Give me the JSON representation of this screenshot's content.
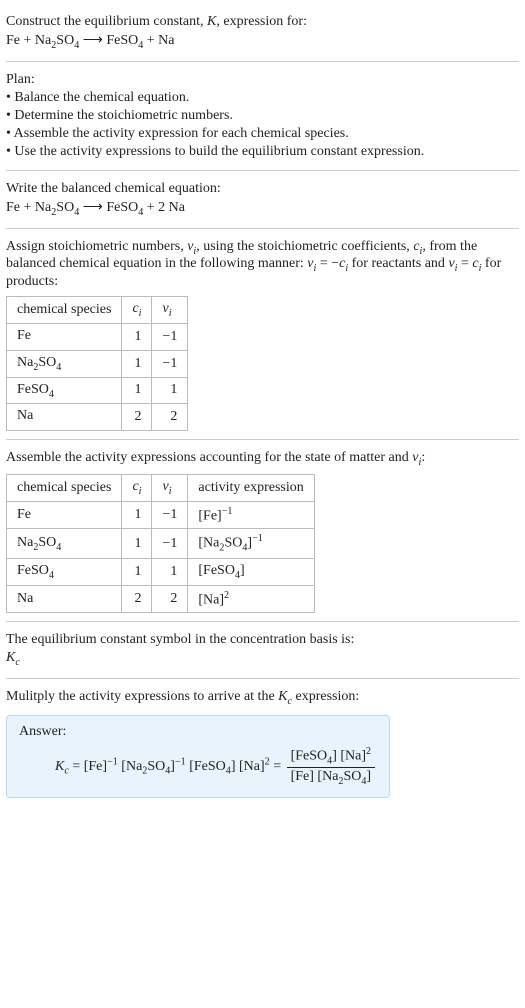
{
  "intro": {
    "line1_a": "Construct the equilibrium constant, ",
    "line1_K": "K",
    "line1_b": ", expression for:",
    "eq_lhs_1": "Fe + Na",
    "eq_lhs_2": "2",
    "eq_lhs_3": "SO",
    "eq_lhs_4": "4",
    "arrow": "  ⟶  ",
    "eq_rhs_1": "FeSO",
    "eq_rhs_2": "4",
    "eq_rhs_3": " + Na"
  },
  "plan": {
    "title": "Plan:",
    "b1": "• Balance the chemical equation.",
    "b2": "• Determine the stoichiometric numbers.",
    "b3": "• Assemble the activity expression for each chemical species.",
    "b4": "• Use the activity expressions to build the equilibrium constant expression."
  },
  "balanced": {
    "title": "Write the balanced chemical equation:",
    "l1": "Fe + Na",
    "l2": "2",
    "l3": "SO",
    "l4": "4",
    "arrow": "  ⟶  ",
    "r1": "FeSO",
    "r2": "4",
    "r3": " + 2 Na"
  },
  "assign": {
    "text_a": "Assign stoichiometric numbers, ",
    "nu": "ν",
    "i": "i",
    "text_b": ", using the stoichiometric coefficients, ",
    "c": "c",
    "text_c": ", from the balanced chemical equation in the following manner: ",
    "eq1_lhs_nu": "ν",
    "eq1_eq": " = −",
    "eq1_rhs_c": "c",
    "text_d": " for reactants and ",
    "eq2_eq": " = ",
    "text_e": " for products:"
  },
  "table1": {
    "h1": "chemical species",
    "h2_c": "c",
    "h2_i": "i",
    "h3_nu": "ν",
    "h3_i": "i",
    "rows": [
      {
        "sp_a": "Fe",
        "sp_b": "",
        "sp_c": "",
        "sp_d": "",
        "c": "1",
        "nu": "−1"
      },
      {
        "sp_a": "Na",
        "sp_b": "2",
        "sp_c": "SO",
        "sp_d": "4",
        "c": "1",
        "nu": "−1"
      },
      {
        "sp_a": "FeSO",
        "sp_b": "4",
        "sp_c": "",
        "sp_d": "",
        "c": "1",
        "nu": "1"
      },
      {
        "sp_a": "Na",
        "sp_b": "",
        "sp_c": "",
        "sp_d": "",
        "c": "2",
        "nu": "2"
      }
    ]
  },
  "assemble": {
    "text_a": "Assemble the activity expressions accounting for the state of matter and ",
    "nu": "ν",
    "i": "i",
    "colon": ":"
  },
  "table2": {
    "h1": "chemical species",
    "h2_c": "c",
    "h2_i": "i",
    "h3_nu": "ν",
    "h3_i": "i",
    "h4": "activity expression",
    "rows": [
      {
        "sp_a": "Fe",
        "sp_b": "",
        "sp_c": "",
        "sp_d": "",
        "c": "1",
        "nu": "−1",
        "ax_a": "[Fe]",
        "ax_sup": "−1",
        "ax_b": ""
      },
      {
        "sp_a": "Na",
        "sp_b": "2",
        "sp_c": "SO",
        "sp_d": "4",
        "c": "1",
        "nu": "−1",
        "ax_a": "[Na",
        "ax_sub1": "2",
        "ax_mid": "SO",
        "ax_sub2": "4",
        "ax_close": "]",
        "ax_sup": "−1"
      },
      {
        "sp_a": "FeSO",
        "sp_b": "4",
        "sp_c": "",
        "sp_d": "",
        "c": "1",
        "nu": "1",
        "ax_a": "[FeSO",
        "ax_sub1": "4",
        "ax_close": "]",
        "ax_sup": ""
      },
      {
        "sp_a": "Na",
        "sp_b": "",
        "sp_c": "",
        "sp_d": "",
        "c": "2",
        "nu": "2",
        "ax_a": "[Na]",
        "ax_sup": "2"
      }
    ]
  },
  "kc_symbol": {
    "text": "The equilibrium constant symbol in the concentration basis is:",
    "K": "K",
    "c": "c"
  },
  "multiply": {
    "text_a": "Mulitply the activity expressions to arrive at the ",
    "K": "K",
    "c": "c",
    "text_b": " expression:"
  },
  "answer": {
    "label": "Answer:",
    "K": "K",
    "c": "c",
    "eq": " = ",
    "p1": "[Fe]",
    "p1_sup": "−1",
    "p2_a": " [Na",
    "p2_sub1": "2",
    "p2_b": "SO",
    "p2_sub2": "4",
    "p2_c": "]",
    "p2_sup": "−1",
    "p3_a": " [FeSO",
    "p3_sub": "4",
    "p3_b": "]",
    "p4": " [Na]",
    "p4_sup": "2",
    "eq2": " = ",
    "num_a": "[FeSO",
    "num_sub": "4",
    "num_b": "] [Na]",
    "num_sup": "2",
    "den_a": "[Fe] [Na",
    "den_sub1": "2",
    "den_b": "SO",
    "den_sub2": "4",
    "den_c": "]"
  }
}
